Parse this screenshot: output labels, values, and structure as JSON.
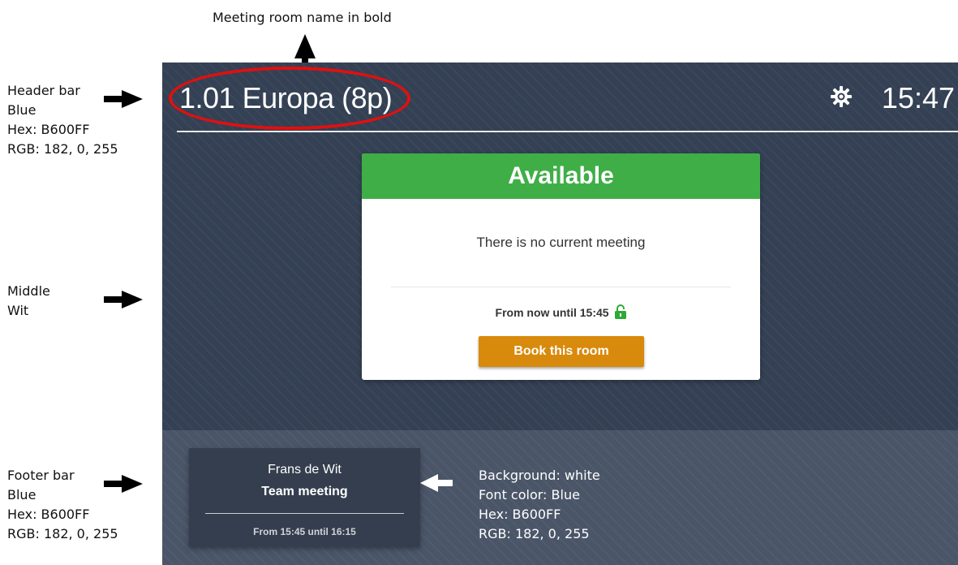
{
  "annotations": {
    "top": "Meeting room name in bold",
    "header": "Header bar\nBlue\nHex: B600FF\nRGB: 182, 0, 255",
    "middle": "Middle\nWit",
    "footer": "Footer bar\nBlue\nHex: B600FF\nRGB: 182, 0, 255",
    "card": "Background: white\nFont color: Blue\nHex: B600FF\nRGB: 182, 0, 255"
  },
  "header": {
    "room_name": "1.01 Europa (8p)",
    "clock": "15:47",
    "settings_icon": "gear-icon"
  },
  "status": {
    "title": "Available",
    "message": "There is no current meeting",
    "availability": "From now until 15:45",
    "lock_icon": "unlocked-padlock-icon",
    "book_label": "Book this room"
  },
  "footer": {
    "next_meeting": {
      "organizer": "Frans de Wit",
      "title": "Team meeting",
      "time": "From 15:45 until 16:15"
    }
  },
  "colors": {
    "panel_bg": "#344053",
    "footer_bg": "#4a5568",
    "available_green": "#3fae47",
    "book_button": "#d88a0c",
    "annotation_ellipse": "#e01010",
    "lock_green": "#2fa838"
  }
}
